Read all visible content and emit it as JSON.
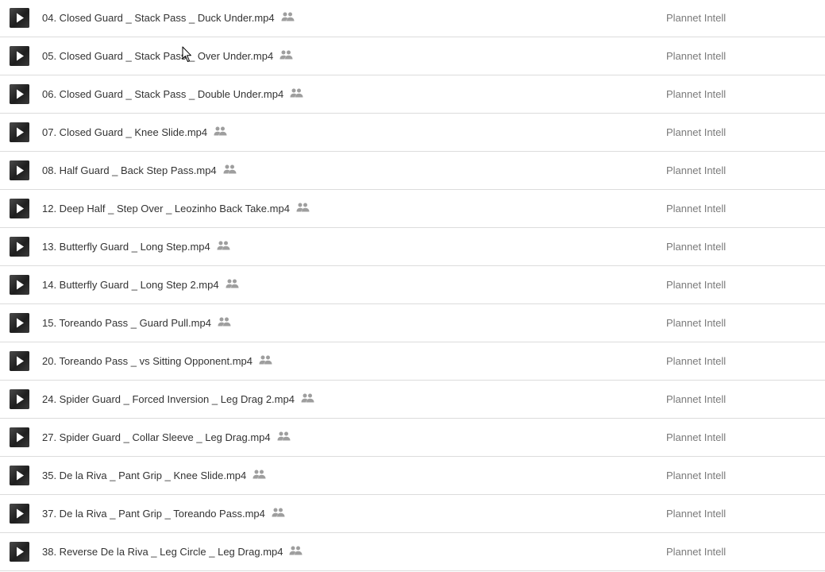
{
  "files": [
    {
      "name": "04. Closed Guard _ Stack Pass _ Duck Under.mp4",
      "owner": "Plannet Intell"
    },
    {
      "name": "05. Closed Guard _ Stack Pass _ Over Under.mp4",
      "owner": "Plannet Intell"
    },
    {
      "name": "06. Closed Guard _ Stack Pass _ Double Under.mp4",
      "owner": "Plannet Intell"
    },
    {
      "name": "07. Closed Guard _ Knee Slide.mp4",
      "owner": "Plannet Intell"
    },
    {
      "name": "08. Half Guard _ Back Step Pass.mp4",
      "owner": "Plannet Intell"
    },
    {
      "name": "12. Deep Half _ Step Over _ Leozinho Back Take.mp4",
      "owner": "Plannet Intell"
    },
    {
      "name": "13. Butterfly Guard _ Long Step.mp4",
      "owner": "Plannet Intell"
    },
    {
      "name": "14. Butterfly Guard _ Long Step 2.mp4",
      "owner": "Plannet Intell"
    },
    {
      "name": "15. Toreando Pass _ Guard Pull.mp4",
      "owner": "Plannet Intell"
    },
    {
      "name": "20. Toreando Pass _ vs Sitting Opponent.mp4",
      "owner": "Plannet Intell"
    },
    {
      "name": "24. Spider Guard _ Forced Inversion _ Leg Drag 2.mp4",
      "owner": "Plannet Intell"
    },
    {
      "name": "27. Spider Guard _ Collar Sleeve _ Leg Drag.mp4",
      "owner": "Plannet Intell"
    },
    {
      "name": "35. De la Riva _ Pant Grip _ Knee Slide.mp4",
      "owner": "Plannet Intell"
    },
    {
      "name": "37. De la Riva _ Pant Grip _ Toreando Pass.mp4",
      "owner": "Plannet Intell"
    },
    {
      "name": "38. Reverse De la Riva _ Leg Circle _ Leg Drag.mp4",
      "owner": "Plannet Intell"
    }
  ],
  "icons": {
    "file_type": "video-play-icon",
    "shared": "shared-people-icon",
    "cursor": "mouse-pointer-icon"
  },
  "colors": {
    "text": "#333333",
    "owner_text": "#7a7a7a",
    "divider": "#dcdcdc",
    "shared_icon": "#9e9e9e"
  }
}
